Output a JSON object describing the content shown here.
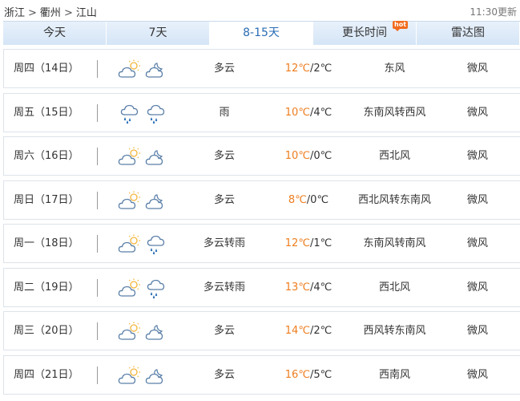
{
  "breadcrumb": [
    "浙江",
    "衢州",
    "江山"
  ],
  "updated": "11:30更新",
  "tabs": [
    {
      "label": "今天"
    },
    {
      "label": "7天"
    },
    {
      "label": "8-15天"
    },
    {
      "label": "更长时间",
      "badge": "hot"
    },
    {
      "label": "雷达图"
    }
  ],
  "active_tab": "8-15天",
  "forecast": [
    {
      "date": "周四（14日）",
      "icons": [
        "cloudy-day-icon",
        "cloudy-night-icon"
      ],
      "desc": "多云",
      "high": "12℃",
      "low": "/2℃",
      "wind": "东风",
      "level": "微风"
    },
    {
      "date": "周五（15日）",
      "icons": [
        "rain-icon",
        "rain-icon"
      ],
      "desc": "雨",
      "high": "10℃",
      "low": "/4℃",
      "wind": "东南风转西风",
      "level": "微风"
    },
    {
      "date": "周六（16日）",
      "icons": [
        "cloudy-day-icon",
        "cloudy-night-icon"
      ],
      "desc": "多云",
      "high": "10℃",
      "low": "/0℃",
      "wind": "西北风",
      "level": "微风"
    },
    {
      "date": "周日（17日）",
      "icons": [
        "cloudy-day-icon",
        "cloudy-night-icon"
      ],
      "desc": "多云",
      "high": "8℃",
      "low": "/0℃",
      "wind": "西北风转东南风",
      "level": "微风"
    },
    {
      "date": "周一（18日）",
      "icons": [
        "cloudy-day-icon",
        "rain-icon"
      ],
      "desc": "多云转雨",
      "high": "12℃",
      "low": "/1℃",
      "wind": "东南风转南风",
      "level": "微风"
    },
    {
      "date": "周二（19日）",
      "icons": [
        "cloudy-day-icon",
        "rain-icon"
      ],
      "desc": "多云转雨",
      "high": "13℃",
      "low": "/4℃",
      "wind": "西北风",
      "level": "微风"
    },
    {
      "date": "周三（20日）",
      "icons": [
        "cloudy-day-icon",
        "cloudy-night-icon"
      ],
      "desc": "多云",
      "high": "14℃",
      "low": "/2℃",
      "wind": "西风转东南风",
      "level": "微风"
    },
    {
      "date": "周四（21日）",
      "icons": [
        "cloudy-day-icon",
        "cloudy-night-icon"
      ],
      "desc": "多云",
      "high": "16℃",
      "low": "/5℃",
      "wind": "西南风",
      "level": "微风"
    }
  ],
  "colors": {
    "accent": "#2a6db5",
    "high_temp": "#ee7d1e",
    "tab_bg": "#d5e5f6",
    "icon_stroke": "#5a7fa8",
    "sun": "#f4b63a"
  }
}
